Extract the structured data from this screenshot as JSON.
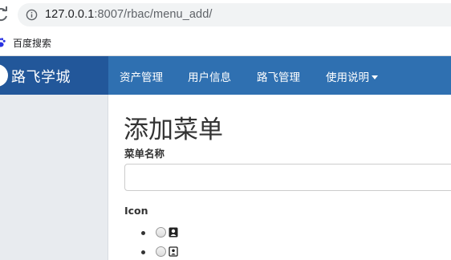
{
  "browser": {
    "url_host": "127.0.0.1",
    "url_rest": ":8007/rbac/menu_add/"
  },
  "bookmarks": {
    "items": [
      {
        "label": "百度搜索"
      }
    ]
  },
  "navbar": {
    "brand": "路飞学城",
    "items": [
      {
        "label": "资产管理"
      },
      {
        "label": "用户信息"
      },
      {
        "label": "路飞管理"
      },
      {
        "label": "使用说明"
      }
    ]
  },
  "form": {
    "title": "添加菜单",
    "name_label": "菜单名称",
    "name_value": "",
    "icon_label": "Icon",
    "icon_options": [
      {
        "icon": "address-book-icon",
        "selected": false
      },
      {
        "icon": "address-card-icon",
        "selected": false
      }
    ]
  },
  "colors": {
    "navbar": "#2f70b1",
    "brand_box": "#22579a",
    "sidebar": "#e8ebef"
  }
}
